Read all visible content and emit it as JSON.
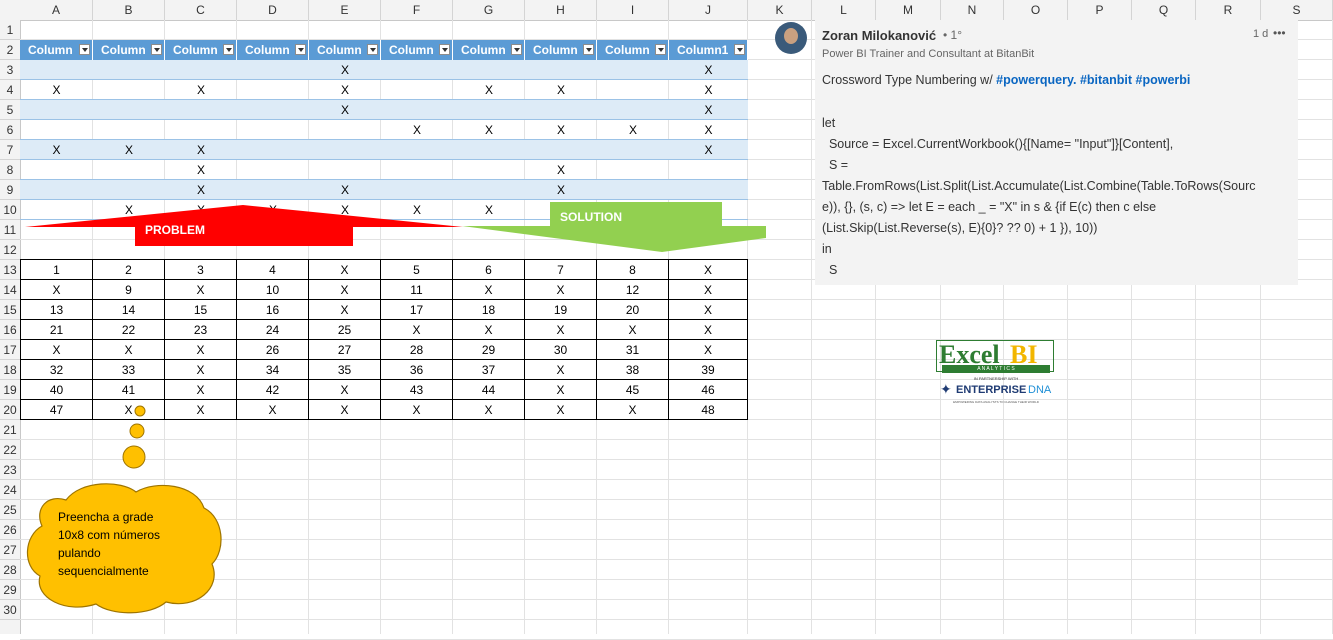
{
  "columns": [
    "A",
    "B",
    "C",
    "D",
    "E",
    "F",
    "G",
    "H",
    "I",
    "J",
    "K",
    "L",
    "M",
    "N",
    "O",
    "P",
    "Q",
    "R",
    "S"
  ],
  "rows": [
    "1",
    "2",
    "3",
    "4",
    "5",
    "6",
    "7",
    "8",
    "9",
    "10",
    "11",
    "12",
    "13",
    "14",
    "15",
    "16",
    "17",
    "18",
    "19",
    "20",
    "21",
    "22",
    "23",
    "24",
    "25",
    "26",
    "27",
    "28",
    "29",
    "30"
  ],
  "table_headers": [
    "Column",
    "Column",
    "Column",
    "Column",
    "Column",
    "Column",
    "Column",
    "Column",
    "Column",
    "Column1"
  ],
  "problem_rows": [
    [
      "",
      "",
      "",
      "",
      "X",
      "",
      "",
      "",
      "",
      "X"
    ],
    [
      "X",
      "",
      "X",
      "",
      "X",
      "",
      "X",
      "X",
      "",
      "X"
    ],
    [
      "",
      "",
      "",
      "",
      "X",
      "",
      "",
      "",
      "",
      "X"
    ],
    [
      "",
      "",
      "",
      "",
      "",
      "X",
      "X",
      "X",
      "X",
      "X"
    ],
    [
      "X",
      "X",
      "X",
      "",
      "",
      "",
      "",
      "",
      "",
      "X"
    ],
    [
      "",
      "",
      "X",
      "",
      "",
      "",
      "",
      "X",
      "",
      ""
    ],
    [
      "",
      "",
      "X",
      "",
      "X",
      "",
      "",
      "X",
      "",
      ""
    ],
    [
      "",
      "X",
      "X",
      "X",
      "X",
      "X",
      "X",
      "",
      "",
      ""
    ]
  ],
  "solution_rows": [
    [
      "1",
      "2",
      "3",
      "4",
      "X",
      "5",
      "6",
      "7",
      "8",
      "X"
    ],
    [
      "X",
      "9",
      "X",
      "10",
      "X",
      "11",
      "X",
      "X",
      "12",
      "X"
    ],
    [
      "13",
      "14",
      "15",
      "16",
      "X",
      "17",
      "18",
      "19",
      "20",
      "X"
    ],
    [
      "21",
      "22",
      "23",
      "24",
      "25",
      "X",
      "X",
      "X",
      "X",
      "X"
    ],
    [
      "X",
      "X",
      "X",
      "26",
      "27",
      "28",
      "29",
      "30",
      "31",
      "X"
    ],
    [
      "32",
      "33",
      "X",
      "34",
      "35",
      "36",
      "37",
      "X",
      "38",
      "39"
    ],
    [
      "40",
      "41",
      "X",
      "42",
      "X",
      "43",
      "44",
      "X",
      "45",
      "46"
    ],
    [
      "47",
      "X",
      "X",
      "X",
      "X",
      "X",
      "X",
      "X",
      "X",
      "48"
    ]
  ],
  "labels": {
    "problem": "PROBLEM",
    "solution": "SOLUTION"
  },
  "callout": [
    "Preencha a grade",
    "10x8 com números",
    "pulando",
    "sequencialmente"
  ],
  "post": {
    "author": "Zoran Milokanović",
    "degree": "• 1°",
    "headline": "Power BI Trainer and Consultant at BitanBit",
    "time": "1 d",
    "more": "•••",
    "title_text": "Crossword Type Numbering w/ ",
    "hashtags": "#powerquery. #bitanbit #powerbi",
    "code": [
      "let",
      "  Source = Excel.CurrentWorkbook(){[Name= \"Input\"]}[Content],",
      "  S =",
      "Table.FromRows(List.Split(List.Accumulate(List.Combine(Table.ToRows(Sourc",
      "e)), {}, (s, c) => let E = each _ = \"X\" in s & {if E(c) then c else",
      "(List.Skip(List.Reverse(s), E){0}? ?? 0) + 1 }), 10))",
      "in",
      "  S"
    ]
  },
  "logo": {
    "main": "Excel",
    "bi": "BI",
    "sub": "A N A L Y T I C S",
    "partner": "IN PARTNERSHIP WITH",
    "brand": "ENTERPRISE",
    "brand2": "DNA",
    "tagline": "EMPOWERING DATA ANALYSTS TO CHANGE THEIR WORLD"
  },
  "colors": {
    "table_header": "#5b9bd5",
    "band": "#ddebf7",
    "problem_arrow": "#ff0000",
    "solution_arrow": "#92d050",
    "callout": "#ffc000",
    "hashtag": "#0a66c2"
  }
}
